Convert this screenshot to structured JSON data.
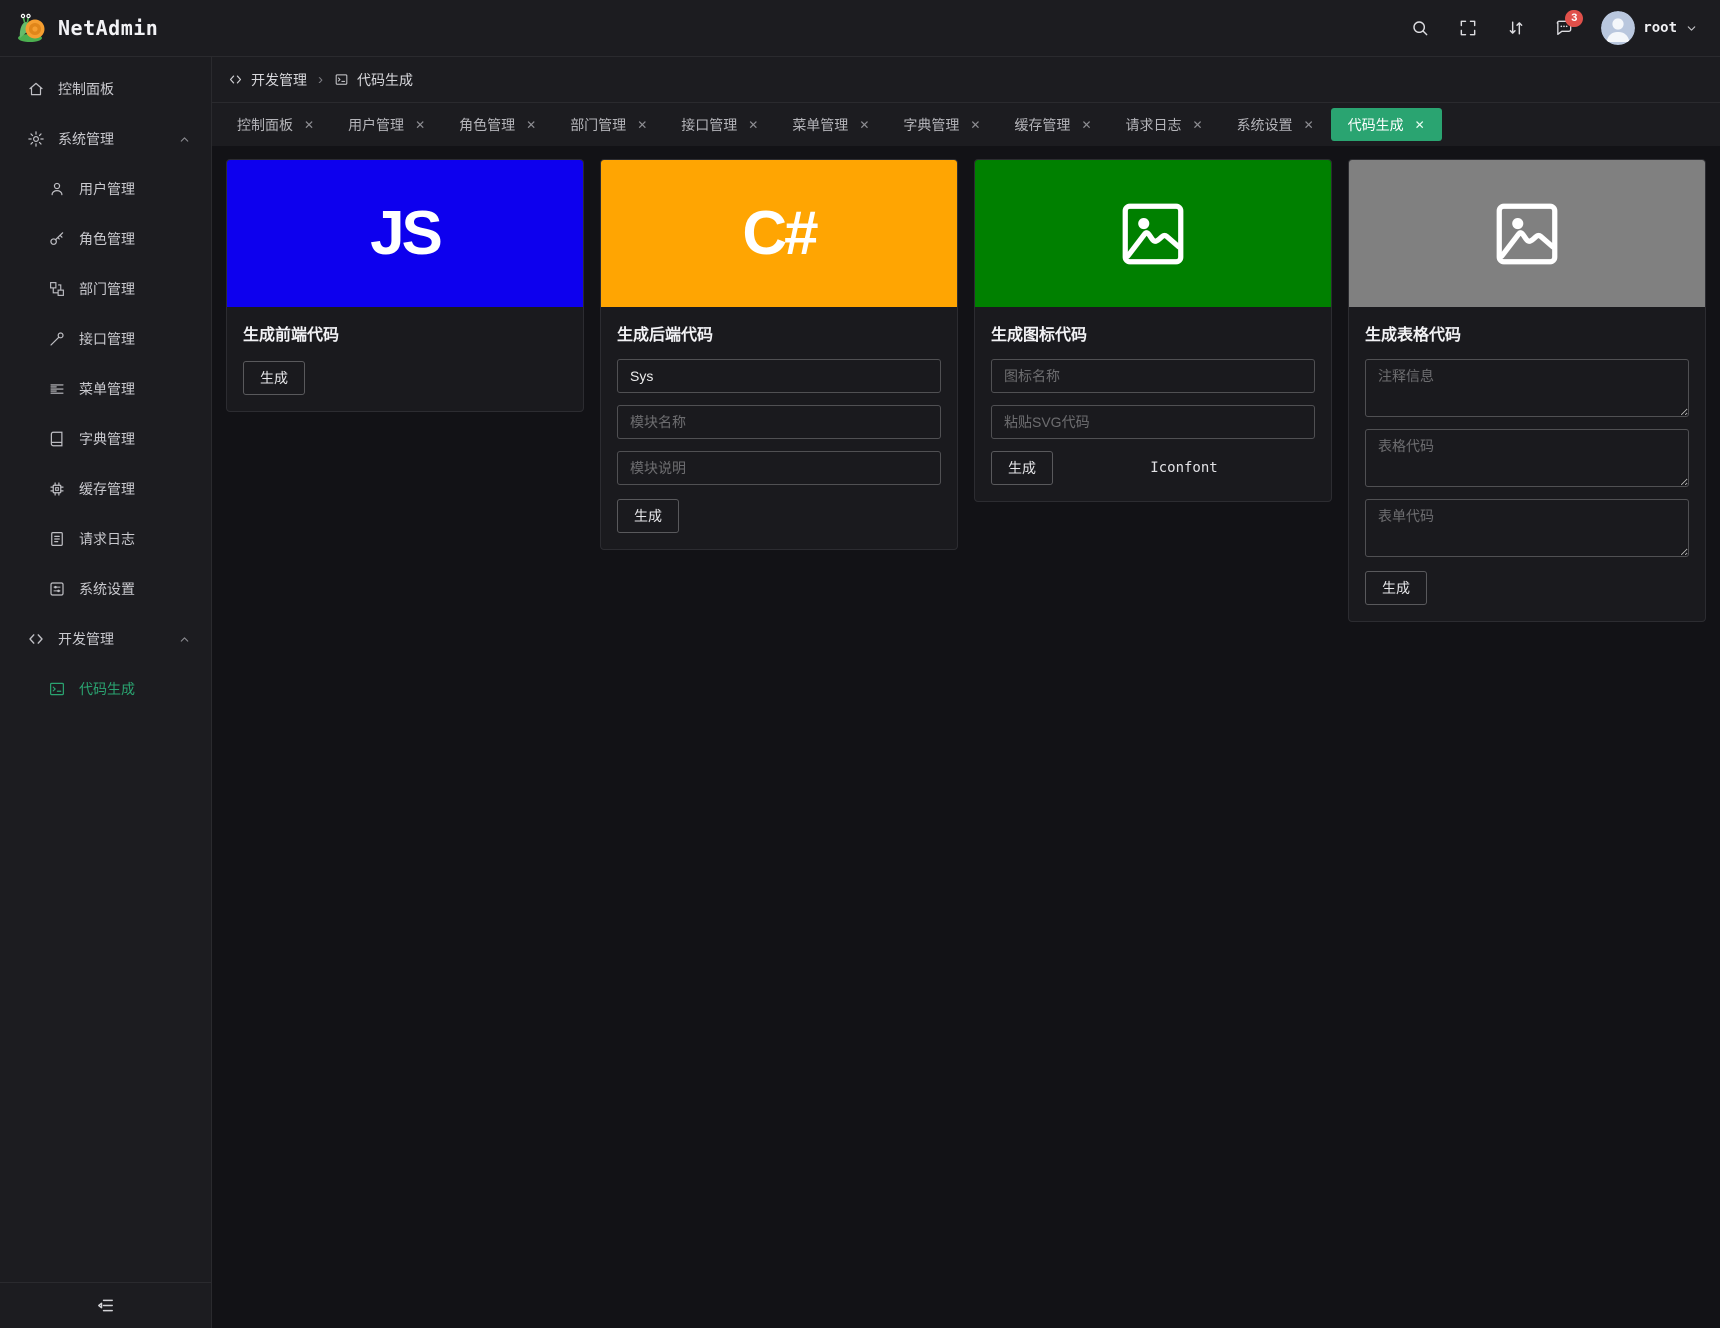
{
  "app": {
    "title": "NetAdmin",
    "logo_icon": "snail-icon"
  },
  "colors": {
    "primary": "#2aa471",
    "badge": "#e0504a",
    "avatar_bg": "#b9c7de"
  },
  "icons": {
    "close": "✕",
    "breadcrumb_separator": "›"
  },
  "header": {
    "notification_count": "3",
    "user": {
      "name": "root"
    }
  },
  "breadcrumb": {
    "items": [
      {
        "label": "开发管理",
        "icon": "code-icon"
      },
      {
        "label": "代码生成",
        "icon": "terminal-window-icon"
      }
    ]
  },
  "tabs": [
    {
      "label": "控制面板"
    },
    {
      "label": "用户管理"
    },
    {
      "label": "角色管理"
    },
    {
      "label": "部门管理"
    },
    {
      "label": "接口管理"
    },
    {
      "label": "菜单管理"
    },
    {
      "label": "字典管理"
    },
    {
      "label": "缓存管理"
    },
    {
      "label": "请求日志"
    },
    {
      "label": "系统设置"
    },
    {
      "label": "代码生成",
      "active": true
    }
  ],
  "sidebar": {
    "items": [
      {
        "label": "控制面板",
        "icon": "home-icon"
      },
      {
        "label": "系统管理",
        "icon": "gear-icon",
        "expanded": true,
        "children": [
          {
            "label": "用户管理",
            "icon": "user-icon"
          },
          {
            "label": "角色管理",
            "icon": "key-icon"
          },
          {
            "label": "部门管理",
            "icon": "org-icon"
          },
          {
            "label": "接口管理",
            "icon": "api-icon"
          },
          {
            "label": "菜单管理",
            "icon": "menu-list-icon"
          },
          {
            "label": "字典管理",
            "icon": "book-icon"
          },
          {
            "label": "缓存管理",
            "icon": "cpu-icon"
          },
          {
            "label": "请求日志",
            "icon": "document-icon"
          },
          {
            "label": "系统设置",
            "icon": "settings-panel-icon"
          }
        ]
      },
      {
        "label": "开发管理",
        "icon": "code-icon",
        "expanded": true,
        "children": [
          {
            "label": "代码生成",
            "icon": "terminal-window-icon",
            "active": true
          }
        ]
      }
    ]
  },
  "cards": [
    {
      "title": "生成前端代码",
      "banner": {
        "text": "JS",
        "color": "#0d00ee"
      },
      "generate_label": "生成"
    },
    {
      "title": "生成后端代码",
      "banner": {
        "text": "C#",
        "color": "#ffa502"
      },
      "inputs": [
        {
          "value": "Sys"
        },
        {
          "placeholder": "模块名称"
        },
        {
          "placeholder": "模块说明"
        }
      ],
      "generate_label": "生成"
    },
    {
      "title": "生成图标代码",
      "banner": {
        "icon": "picture-icon",
        "color": "#008000"
      },
      "inputs": [
        {
          "placeholder": "图标名称"
        },
        {
          "placeholder": "粘贴SVG代码"
        }
      ],
      "generate_label": "生成",
      "link_label": "Iconfont"
    },
    {
      "title": "生成表格代码",
      "banner": {
        "icon": "picture-icon",
        "color": "#808080"
      },
      "textareas": [
        {
          "placeholder": "注释信息"
        },
        {
          "placeholder": "表格代码"
        },
        {
          "placeholder": "表单代码"
        }
      ],
      "generate_label": "生成"
    }
  ]
}
